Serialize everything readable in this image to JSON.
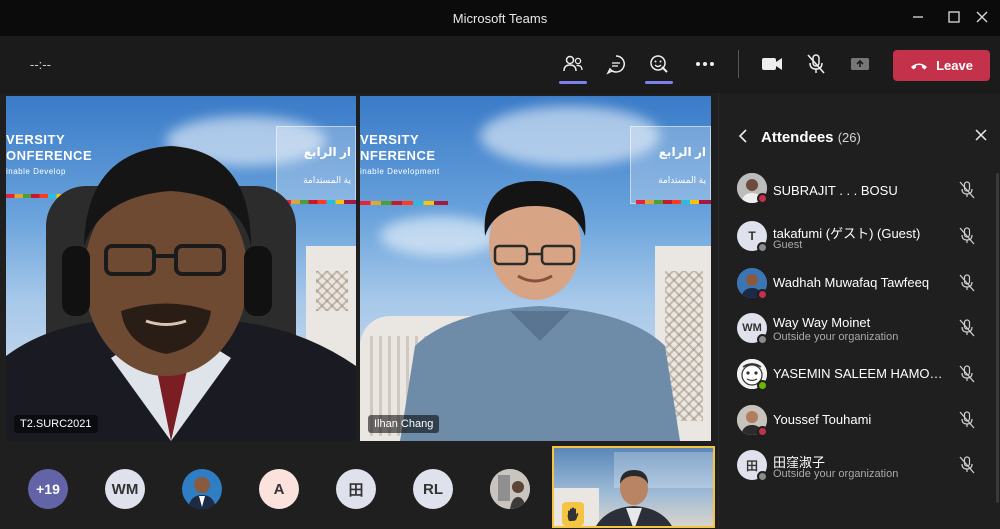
{
  "window": {
    "title": "Microsoft Teams"
  },
  "toolbar": {
    "timer": "--:--",
    "leave_label": "Leave"
  },
  "videos": [
    {
      "name": "T2.SURC2021",
      "banner_line1": "VERSITY",
      "banner_line2": "ONFERENCE",
      "banner_line3": "inable Develop",
      "arabic": "ار الرابع",
      "arabic2": "ية المستدامة"
    },
    {
      "name": "Ilhan Chang",
      "banner_line1": "VERSITY",
      "banner_line2": "NFERENCE",
      "banner_line3": "inable Development",
      "arabic": "ار الرابع",
      "arabic2": "ية المستدامة"
    }
  ],
  "strip": {
    "overflow": "+19",
    "avatars": [
      "WM",
      "A",
      "田",
      "RL"
    ]
  },
  "attendees_panel": {
    "title": "Attendees",
    "count": "(26)",
    "items": [
      {
        "name": "SUBRAJIT . . . BOSU",
        "subtitle": ""
      },
      {
        "name": "takafumi (ゲスト) (Guest)",
        "subtitle": "Guest",
        "initial": "T"
      },
      {
        "name": "Wadhah Muwafaq Tawfeeq",
        "subtitle": ""
      },
      {
        "name": "Way Way Moinet",
        "subtitle": "Outside your organization",
        "initial": "WM"
      },
      {
        "name": "YASEMIN SALEEM HAMOOD ...",
        "subtitle": ""
      },
      {
        "name": "Youssef Touhami",
        "subtitle": ""
      },
      {
        "name": "田窪淑子",
        "subtitle": "Outside your organization",
        "initial": "田"
      }
    ]
  },
  "colors": {
    "accent": "#7b83eb",
    "leave": "#c4314b",
    "busy": "#c4314b",
    "available": "#6bb700",
    "offline": "#8a8a8a",
    "self_border": "#f4c542"
  }
}
